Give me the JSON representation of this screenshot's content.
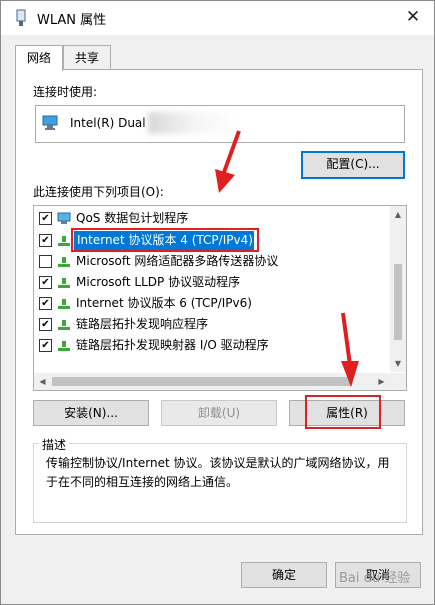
{
  "window": {
    "title": "WLAN 属性",
    "close_glyph": "✕"
  },
  "tabs": [
    {
      "label": "网络",
      "active": true
    },
    {
      "label": "共享",
      "active": false
    }
  ],
  "connect_using": {
    "label": "连接时使用:",
    "adapter_name": "Intel(R) Dual"
  },
  "configure_button": "配置(C)...",
  "items_label": "此连接使用下列项目(O):",
  "items": [
    {
      "label": "QoS 数据包计划程序",
      "checked": true,
      "icon": "qos-icon"
    },
    {
      "label": "Internet 协议版本 4 (TCP/IPv4)",
      "checked": true,
      "icon": "network-protocol-icon",
      "selected": true
    },
    {
      "label": "Microsoft 网络适配器多路传送器协议",
      "checked": false,
      "icon": "network-protocol-icon"
    },
    {
      "label": "Microsoft LLDP 协议驱动程序",
      "checked": true,
      "icon": "network-protocol-icon"
    },
    {
      "label": "Internet 协议版本 6 (TCP/IPv6)",
      "checked": true,
      "icon": "network-protocol-icon"
    },
    {
      "label": "链路层拓扑发现响应程序",
      "checked": true,
      "icon": "network-protocol-icon"
    },
    {
      "label": "链路层拓扑发现映射器 I/O 驱动程序",
      "checked": true,
      "icon": "network-protocol-icon"
    }
  ],
  "buttons": {
    "install": "安装(N)...",
    "uninstall": "卸载(U)",
    "properties": "属性(R)",
    "ok": "确定",
    "cancel": "取消"
  },
  "description": {
    "title": "描述",
    "text_line1": "传输控制协议/Internet 协议。该协议是默认的广域网络协议，用",
    "text_line2": "于在不同的相互连接的网络上通信。"
  },
  "watermark": "Bai du 经验",
  "colors": {
    "accent": "#0078d7",
    "annotation_red": "#e02020"
  }
}
